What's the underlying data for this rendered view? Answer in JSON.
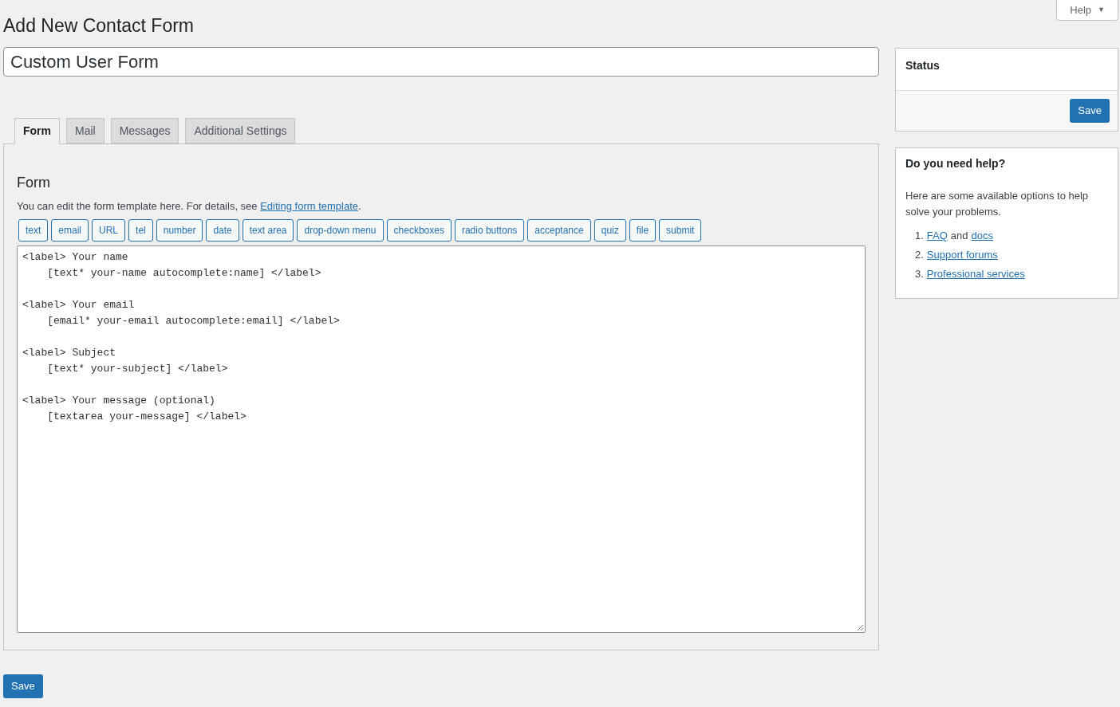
{
  "help_tab": {
    "label": "Help",
    "arrow": "▼"
  },
  "page_title": "Add New Contact Form",
  "form_title": {
    "value": "Custom User Form"
  },
  "tabs": [
    {
      "label": "Form",
      "selected": true
    },
    {
      "label": "Mail",
      "selected": false
    },
    {
      "label": "Messages",
      "selected": false
    },
    {
      "label": "Additional Settings",
      "selected": false
    }
  ],
  "panel": {
    "heading": "Form",
    "description": {
      "before": "You can edit the form template here. For details, see ",
      "link": "Editing form template",
      "after": "."
    },
    "tag_buttons": [
      "text",
      "email",
      "URL",
      "tel",
      "number",
      "date",
      "text area",
      "drop-down menu",
      "checkboxes",
      "radio buttons",
      "acceptance",
      "quiz",
      "file",
      "submit"
    ],
    "template": [
      [
        "<label> Your name",
        "    [text* your-name autocomplete:name] </label>"
      ],
      [
        "<label> Your email",
        "    [email* your-email autocomplete:email] </label>"
      ],
      [
        "<label> Subject",
        "    [text* your-subject] </label>"
      ],
      [
        "<label> Your message (optional)",
        "    [textarea your-message] </label>"
      ]
    ]
  },
  "save_button": "Save",
  "status_box": {
    "title": "Status",
    "button": "Save"
  },
  "help_box": {
    "title": "Do you need help?",
    "text": "Here are some available options to help solve your problems.",
    "items": [
      {
        "number": "1.",
        "parts": [
          {
            "text": "FAQ",
            "kind": "link"
          },
          {
            "text": "and",
            "kind": "text"
          },
          {
            "text": "docs",
            "kind": "link"
          }
        ]
      },
      {
        "number": "2.",
        "parts": [
          {
            "text": "Support forums",
            "kind": "link"
          }
        ]
      },
      {
        "number": "3.",
        "parts": [
          {
            "text": "Professional services",
            "kind": "link"
          }
        ]
      }
    ]
  }
}
